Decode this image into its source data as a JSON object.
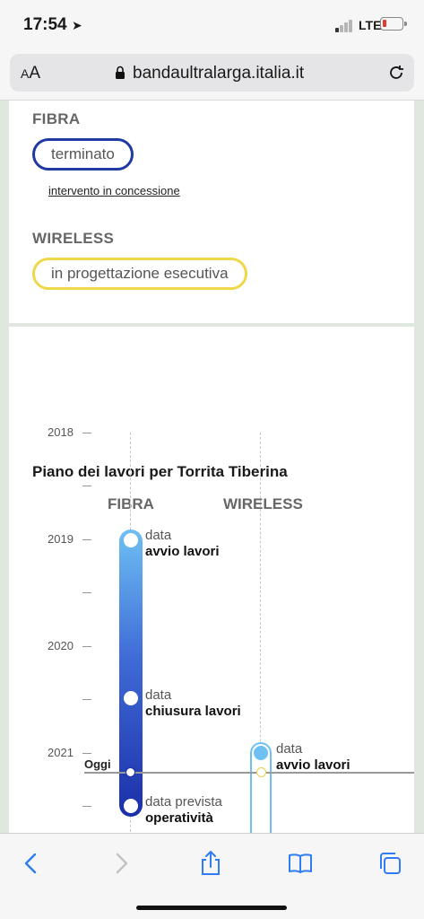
{
  "status": {
    "time": "17:54",
    "network": "LTE"
  },
  "browser": {
    "text_size_label": "AA",
    "url": "bandaultralarga.italia.it"
  },
  "fibra_section": {
    "title": "FIBRA",
    "status": "terminato",
    "link": "intervento in concessione"
  },
  "wireless_section": {
    "title": "WIRELESS",
    "status": "in progettazione esecutiva"
  },
  "timeline": {
    "title": "Piano dei lavori per Torrita Tiberina",
    "columns": [
      "FIBRA",
      "WIRELESS"
    ],
    "years": [
      "2018",
      "2019",
      "2020",
      "2021"
    ],
    "today_label": "Oggi",
    "fibra_events": [
      {
        "line1": "data",
        "line2": "avvio lavori"
      },
      {
        "line1": "data",
        "line2": "chiusura lavori"
      },
      {
        "line1": "data prevista",
        "line2": "operatività"
      }
    ],
    "wireless_events": [
      {
        "line1": "data",
        "line2": "avvio lavori"
      }
    ],
    "colors": {
      "bar_top": "#6ec0f3",
      "bar_bottom": "#1b2fa8",
      "wireless_dot": "#6ec0f3",
      "today_dot": "#e8d24a"
    }
  }
}
